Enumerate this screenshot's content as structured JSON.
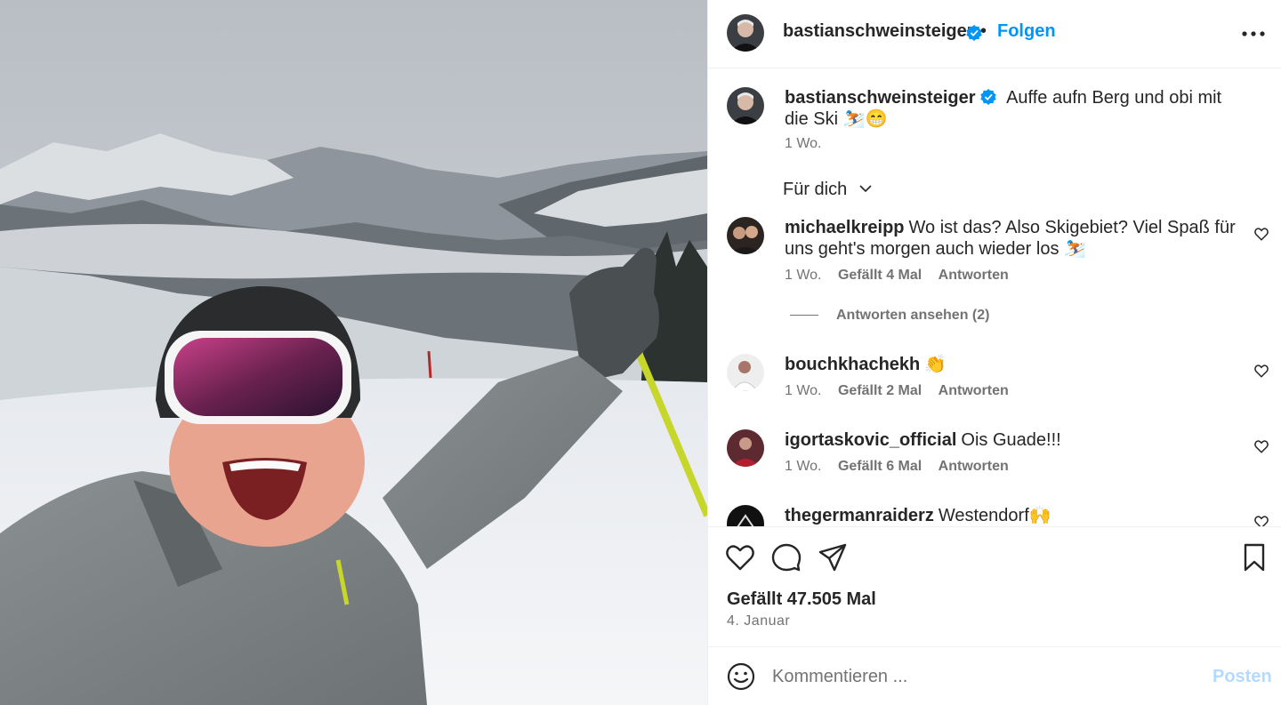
{
  "post": {
    "author": "bastianschweinsteiger",
    "follow_label": "Folgen",
    "dot": "•",
    "caption": "Auffe aufn Berg und obi mit die Ski ⛷️😁",
    "caption_time": "1 Wo."
  },
  "filter_label": "Für dich",
  "comments": [
    {
      "user": "michaelkreipp",
      "text": "Wo ist das? Also Skigebiet? Viel Spaß für uns geht's morgen auch wieder los ⛷️",
      "time": "1 Wo.",
      "likes": "Gefällt 4 Mal",
      "reply": "Antworten"
    },
    {
      "user": "bouchkhachekh",
      "text": "👏",
      "time": "1 Wo.",
      "likes": "Gefällt 2 Mal",
      "reply": "Antworten"
    },
    {
      "user": "igortaskovic_official",
      "text": "Ois Guade!!!",
      "time": "1 Wo.",
      "likes": "Gefällt 6 Mal",
      "reply": "Antworten"
    },
    {
      "user": "thegermanraiderz",
      "text": "Westendorf🙌"
    }
  ],
  "view_replies": "Antworten ansehen (2)",
  "likes_total": "Gefällt 47.505 Mal",
  "post_date": "4. Januar",
  "comment_box": {
    "placeholder": "Kommentieren ...",
    "post_label": "Posten"
  },
  "icons": {
    "verified": "verified-badge-icon",
    "more": "more-options-icon",
    "heart": "heart-icon",
    "comment": "comment-icon",
    "share": "share-icon",
    "save": "bookmark-icon",
    "emoji": "emoji-icon"
  },
  "colors": {
    "link": "#0095f6",
    "verified": "#0095f6",
    "muted": "#737373",
    "post_disabled": "#b3dbff"
  }
}
